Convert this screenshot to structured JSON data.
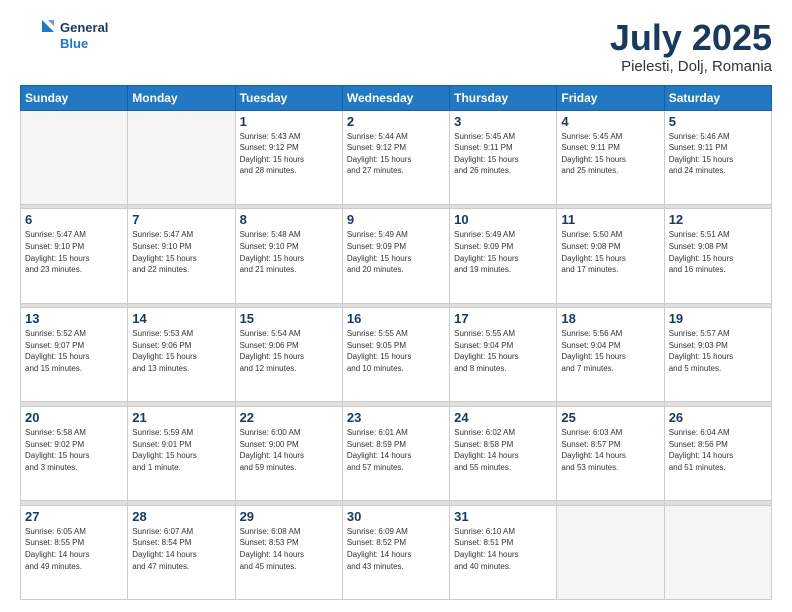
{
  "header": {
    "logo_line1": "General",
    "logo_line2": "Blue",
    "title": "July 2025",
    "subtitle": "Pielesti, Dolj, Romania"
  },
  "weekdays": [
    "Sunday",
    "Monday",
    "Tuesday",
    "Wednesday",
    "Thursday",
    "Friday",
    "Saturday"
  ],
  "weeks": [
    [
      {
        "day": "",
        "info": ""
      },
      {
        "day": "",
        "info": ""
      },
      {
        "day": "1",
        "info": "Sunrise: 5:43 AM\nSunset: 9:12 PM\nDaylight: 15 hours\nand 28 minutes."
      },
      {
        "day": "2",
        "info": "Sunrise: 5:44 AM\nSunset: 9:12 PM\nDaylight: 15 hours\nand 27 minutes."
      },
      {
        "day": "3",
        "info": "Sunrise: 5:45 AM\nSunset: 9:11 PM\nDaylight: 15 hours\nand 26 minutes."
      },
      {
        "day": "4",
        "info": "Sunrise: 5:45 AM\nSunset: 9:11 PM\nDaylight: 15 hours\nand 25 minutes."
      },
      {
        "day": "5",
        "info": "Sunrise: 5:46 AM\nSunset: 9:11 PM\nDaylight: 15 hours\nand 24 minutes."
      }
    ],
    [
      {
        "day": "6",
        "info": "Sunrise: 5:47 AM\nSunset: 9:10 PM\nDaylight: 15 hours\nand 23 minutes."
      },
      {
        "day": "7",
        "info": "Sunrise: 5:47 AM\nSunset: 9:10 PM\nDaylight: 15 hours\nand 22 minutes."
      },
      {
        "day": "8",
        "info": "Sunrise: 5:48 AM\nSunset: 9:10 PM\nDaylight: 15 hours\nand 21 minutes."
      },
      {
        "day": "9",
        "info": "Sunrise: 5:49 AM\nSunset: 9:09 PM\nDaylight: 15 hours\nand 20 minutes."
      },
      {
        "day": "10",
        "info": "Sunrise: 5:49 AM\nSunset: 9:09 PM\nDaylight: 15 hours\nand 19 minutes."
      },
      {
        "day": "11",
        "info": "Sunrise: 5:50 AM\nSunset: 9:08 PM\nDaylight: 15 hours\nand 17 minutes."
      },
      {
        "day": "12",
        "info": "Sunrise: 5:51 AM\nSunset: 9:08 PM\nDaylight: 15 hours\nand 16 minutes."
      }
    ],
    [
      {
        "day": "13",
        "info": "Sunrise: 5:52 AM\nSunset: 9:07 PM\nDaylight: 15 hours\nand 15 minutes."
      },
      {
        "day": "14",
        "info": "Sunrise: 5:53 AM\nSunset: 9:06 PM\nDaylight: 15 hours\nand 13 minutes."
      },
      {
        "day": "15",
        "info": "Sunrise: 5:54 AM\nSunset: 9:06 PM\nDaylight: 15 hours\nand 12 minutes."
      },
      {
        "day": "16",
        "info": "Sunrise: 5:55 AM\nSunset: 9:05 PM\nDaylight: 15 hours\nand 10 minutes."
      },
      {
        "day": "17",
        "info": "Sunrise: 5:55 AM\nSunset: 9:04 PM\nDaylight: 15 hours\nand 8 minutes."
      },
      {
        "day": "18",
        "info": "Sunrise: 5:56 AM\nSunset: 9:04 PM\nDaylight: 15 hours\nand 7 minutes."
      },
      {
        "day": "19",
        "info": "Sunrise: 5:57 AM\nSunset: 9:03 PM\nDaylight: 15 hours\nand 5 minutes."
      }
    ],
    [
      {
        "day": "20",
        "info": "Sunrise: 5:58 AM\nSunset: 9:02 PM\nDaylight: 15 hours\nand 3 minutes."
      },
      {
        "day": "21",
        "info": "Sunrise: 5:59 AM\nSunset: 9:01 PM\nDaylight: 15 hours\nand 1 minute."
      },
      {
        "day": "22",
        "info": "Sunrise: 6:00 AM\nSunset: 9:00 PM\nDaylight: 14 hours\nand 59 minutes."
      },
      {
        "day": "23",
        "info": "Sunrise: 6:01 AM\nSunset: 8:59 PM\nDaylight: 14 hours\nand 57 minutes."
      },
      {
        "day": "24",
        "info": "Sunrise: 6:02 AM\nSunset: 8:58 PM\nDaylight: 14 hours\nand 55 minutes."
      },
      {
        "day": "25",
        "info": "Sunrise: 6:03 AM\nSunset: 8:57 PM\nDaylight: 14 hours\nand 53 minutes."
      },
      {
        "day": "26",
        "info": "Sunrise: 6:04 AM\nSunset: 8:56 PM\nDaylight: 14 hours\nand 51 minutes."
      }
    ],
    [
      {
        "day": "27",
        "info": "Sunrise: 6:05 AM\nSunset: 8:55 PM\nDaylight: 14 hours\nand 49 minutes."
      },
      {
        "day": "28",
        "info": "Sunrise: 6:07 AM\nSunset: 8:54 PM\nDaylight: 14 hours\nand 47 minutes."
      },
      {
        "day": "29",
        "info": "Sunrise: 6:08 AM\nSunset: 8:53 PM\nDaylight: 14 hours\nand 45 minutes."
      },
      {
        "day": "30",
        "info": "Sunrise: 6:09 AM\nSunset: 8:52 PM\nDaylight: 14 hours\nand 43 minutes."
      },
      {
        "day": "31",
        "info": "Sunrise: 6:10 AM\nSunset: 8:51 PM\nDaylight: 14 hours\nand 40 minutes."
      },
      {
        "day": "",
        "info": ""
      },
      {
        "day": "",
        "info": ""
      }
    ]
  ]
}
